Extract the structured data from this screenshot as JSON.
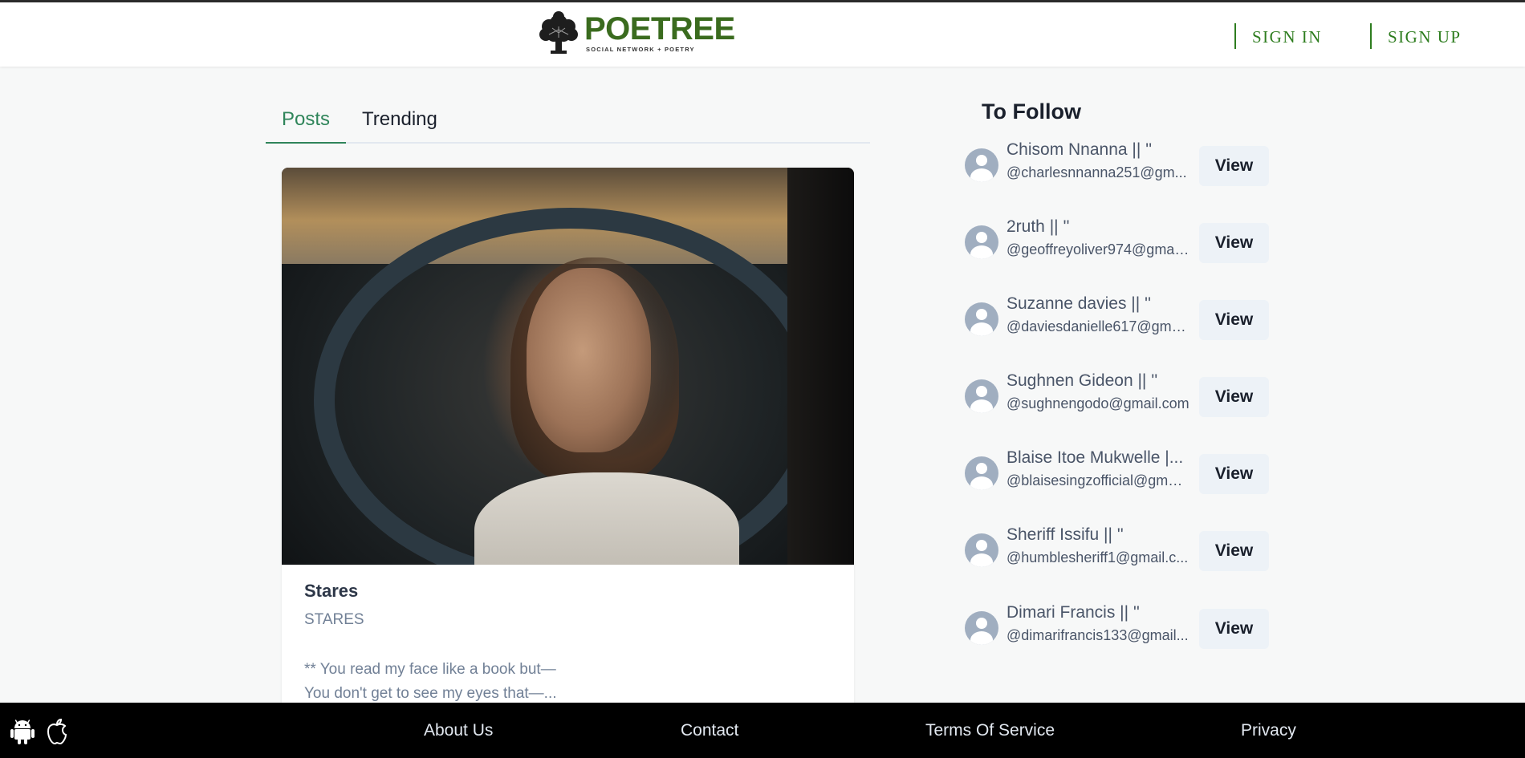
{
  "header": {
    "logo_name": "POETREE",
    "logo_tagline": "SOCIAL NETWORK  +  POETRY",
    "sign_in": "SIGN IN",
    "sign_up": "SIGN UP",
    "brand_color": "#3a6b1e"
  },
  "tabs": [
    {
      "label": "Posts",
      "active": true
    },
    {
      "label": "Trending",
      "active": false
    }
  ],
  "post": {
    "title": "Stares",
    "subtitle": "STARES",
    "excerpt_line1": "** You read my face like a book but—",
    "excerpt_line2": "You don't get to see my eyes that—..."
  },
  "follow": {
    "title": "To Follow",
    "button_label": "View",
    "users": [
      {
        "name": "Chisom Nnanna || ''",
        "handle": "@charlesnnanna251@gm..."
      },
      {
        "name": "2ruth || ''",
        "handle": "@geoffreyoliver974@gmai..."
      },
      {
        "name": "Suzanne davies || ''",
        "handle": "@daviesdanielle617@gma..."
      },
      {
        "name": "Sughnen Gideon || ''",
        "handle": "@sughnengodo@gmail.com"
      },
      {
        "name": "Blaise Itoe Mukwelle |...",
        "handle": "@blaisesingzofficial@gmai..."
      },
      {
        "name": "Sheriff Issifu || ''",
        "handle": "@humblesheriff1@gmail.c..."
      },
      {
        "name": "Dimari Francis || ''",
        "handle": "@dimarifrancis133@gmail..."
      }
    ]
  },
  "footer": {
    "links": [
      "About Us",
      "Contact",
      "Terms Of Service",
      "Privacy"
    ],
    "icons": [
      "android-icon",
      "apple-icon"
    ]
  }
}
